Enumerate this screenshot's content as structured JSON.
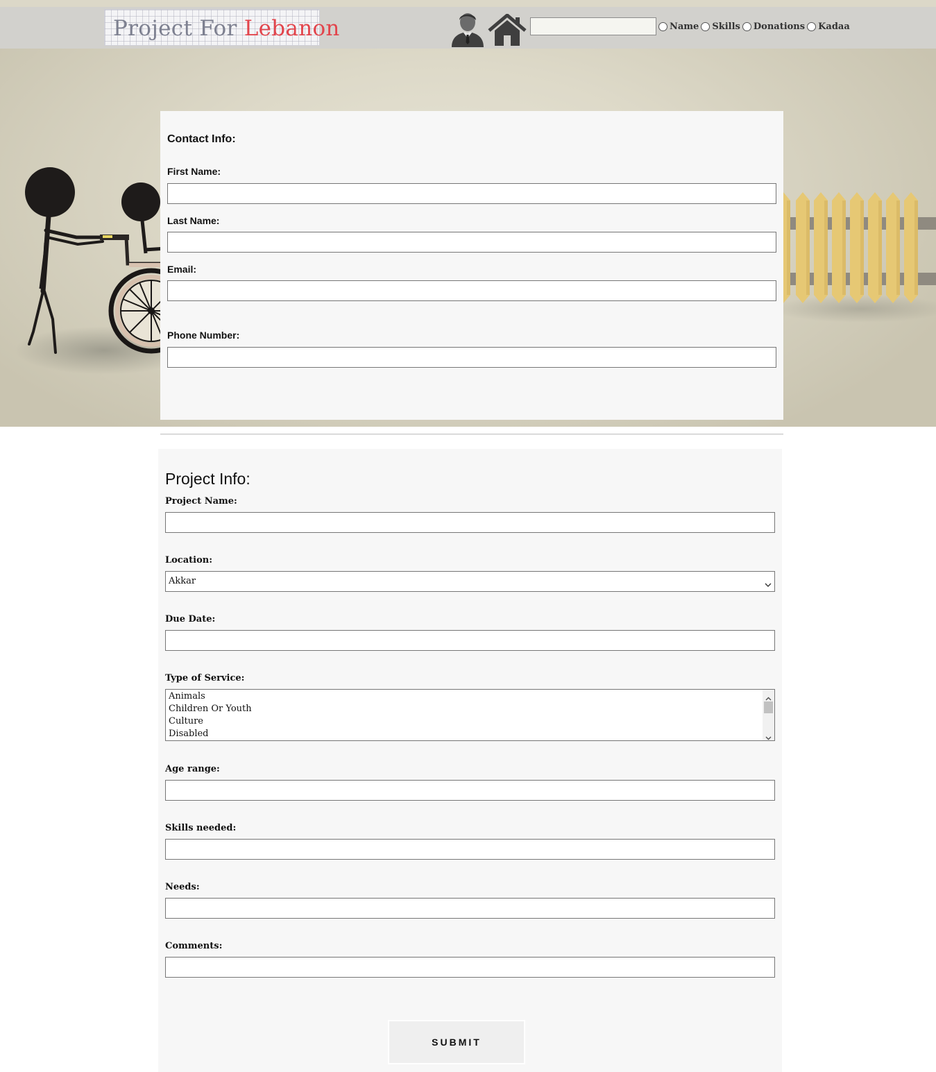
{
  "header": {
    "logo": {
      "word1": "Project For",
      "word2": "Lebanon"
    },
    "icons": {
      "profile": "person-icon",
      "home": "home-icon"
    },
    "search": {
      "value": "",
      "placeholder": ""
    },
    "filters": [
      {
        "label": "Name",
        "checked": false
      },
      {
        "label": "Skills",
        "checked": false
      },
      {
        "label": "Donations",
        "checked": false
      },
      {
        "label": "Kadaa",
        "checked": false
      }
    ]
  },
  "contact": {
    "title": "Contact Info:",
    "first_name": {
      "label": "First Name:",
      "value": ""
    },
    "last_name": {
      "label": "Last Name:",
      "value": ""
    },
    "email": {
      "label": "Email:",
      "value": ""
    },
    "phone": {
      "label": "Phone Number:",
      "value": ""
    }
  },
  "project": {
    "title": "Project Info:",
    "name": {
      "label": "Project Name:",
      "value": ""
    },
    "location": {
      "label": "Location:",
      "selected": "Akkar"
    },
    "due_date": {
      "label": "Due Date:",
      "value": ""
    },
    "service": {
      "label": "Type of Service:",
      "options": [
        "Animals",
        "Children Or Youth",
        "Culture",
        "Disabled"
      ]
    },
    "age_range": {
      "label": "Age range:",
      "value": ""
    },
    "skills": {
      "label": "Skills needed:",
      "value": ""
    },
    "needs": {
      "label": "Needs:",
      "value": ""
    },
    "comments": {
      "label": "Comments:",
      "value": ""
    },
    "submit_label": "SUBMIT"
  },
  "colors": {
    "logo_grey": "#7d8090",
    "logo_red": "#e2454c",
    "fence_yellow": "#e6c874",
    "panel_bg": "#f7f7f7"
  }
}
